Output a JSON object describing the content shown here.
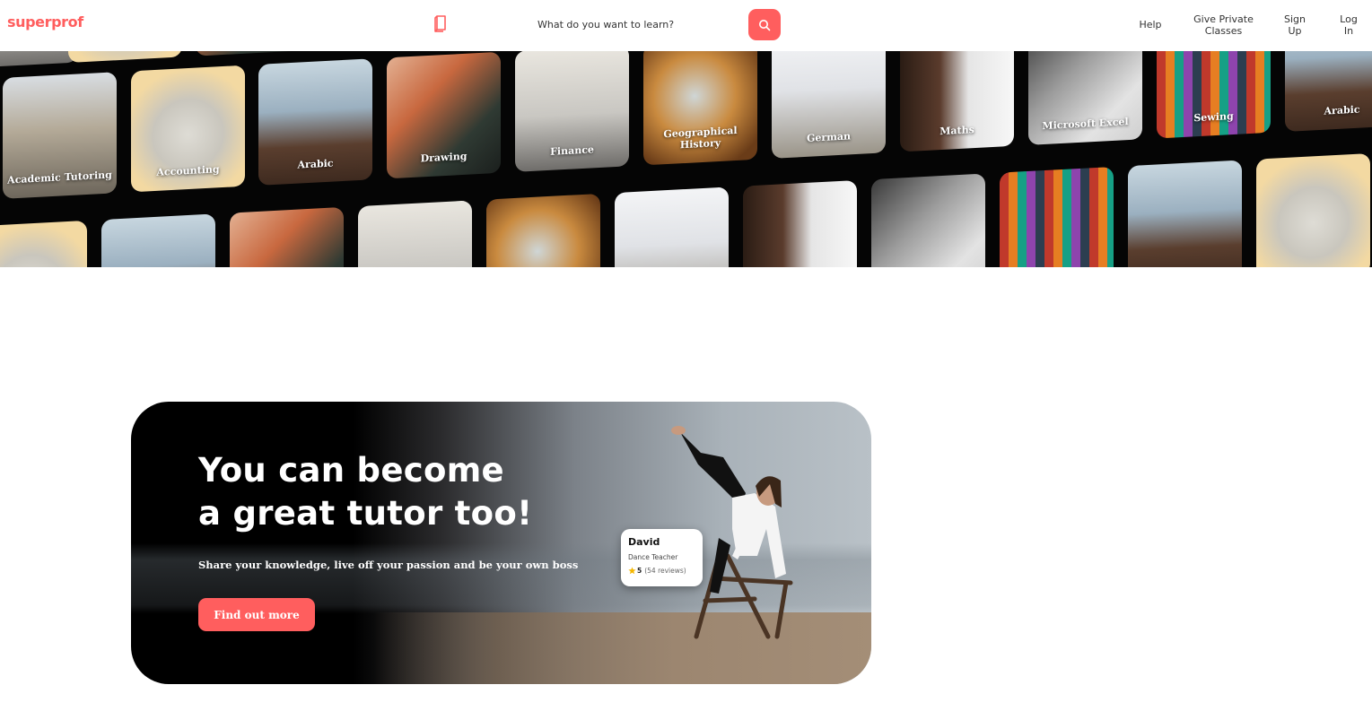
{
  "header": {
    "logo": "superprof",
    "search_placeholder": "What do you want to learn?",
    "nav": {
      "help": "Help",
      "give_private_classes": "Give Private Classes",
      "sign_up": "Sign Up",
      "log_in": "Log In"
    },
    "icons": {
      "book": "book-icon",
      "search": "search-icon"
    }
  },
  "banner": {
    "subjects": [
      "Academic Tutoring",
      "Accounting",
      "Arabic",
      "Drawing",
      "Finance",
      "Geographical History",
      "German",
      "Maths",
      "Microsoft Excel",
      "Sewing",
      "Arabic"
    ]
  },
  "promo": {
    "title_line1": "You can become",
    "title_line2": "a great tutor too!",
    "subtitle": "Share your knowledge, live off your passion and be your own boss",
    "button": "Find out more",
    "tutor": {
      "name": "David",
      "role": "Dance Teacher",
      "score": "5",
      "reviews": "(54 reviews)"
    }
  },
  "colors": {
    "brand": "#ff5e5e",
    "star": "#f5b700"
  }
}
